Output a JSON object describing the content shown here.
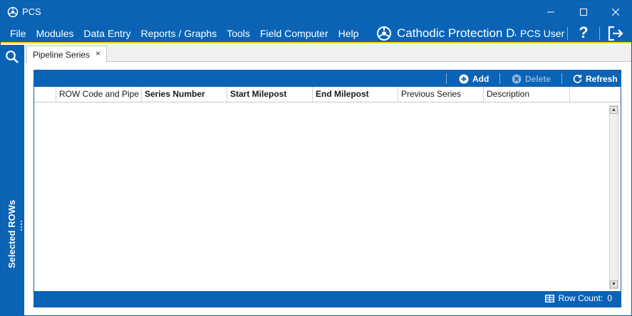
{
  "window": {
    "title": "PCS",
    "minimize_glyph": "—",
    "maximize_glyph": "☐",
    "close_glyph": "✕"
  },
  "menubar": {
    "items": [
      "File",
      "Modules",
      "Data Entry",
      "Reports / Graphs",
      "Tools",
      "Field Computer",
      "Help"
    ],
    "app_title": "Cathodic Protection Da",
    "user_name": "PCS User",
    "help_glyph": "?"
  },
  "sidebar": {
    "label": "Selected ROWs"
  },
  "tabs": [
    {
      "label": "Pipeline Series",
      "close_glyph": "×"
    }
  ],
  "toolbar": {
    "add_label": "Add",
    "delete_label": "Delete",
    "refresh_label": "Refresh"
  },
  "grid": {
    "columns": [
      {
        "label": "",
        "bold": false
      },
      {
        "label": "ROW Code and Pipe",
        "bold": false
      },
      {
        "label": "Series Number",
        "bold": true
      },
      {
        "label": "Start Milepost",
        "bold": true
      },
      {
        "label": "End Milepost",
        "bold": true
      },
      {
        "label": "Previous Series",
        "bold": false
      },
      {
        "label": "Description",
        "bold": false
      }
    ],
    "rows": []
  },
  "status": {
    "row_count_label": "Row Count:",
    "row_count_value": "0"
  },
  "colors": {
    "primary": "#0b63b5",
    "accent_underline": "#f2d200",
    "disabled_text": "#8bb4dc"
  },
  "icons": {
    "app": "pcs-logo-icon",
    "brand": "pcs-logo-icon",
    "help": "question-icon",
    "logout": "logout-icon",
    "search": "search-icon",
    "add": "plus-circle-icon",
    "delete": "x-circle-icon",
    "refresh": "refresh-icon",
    "row_count": "table-icon"
  }
}
